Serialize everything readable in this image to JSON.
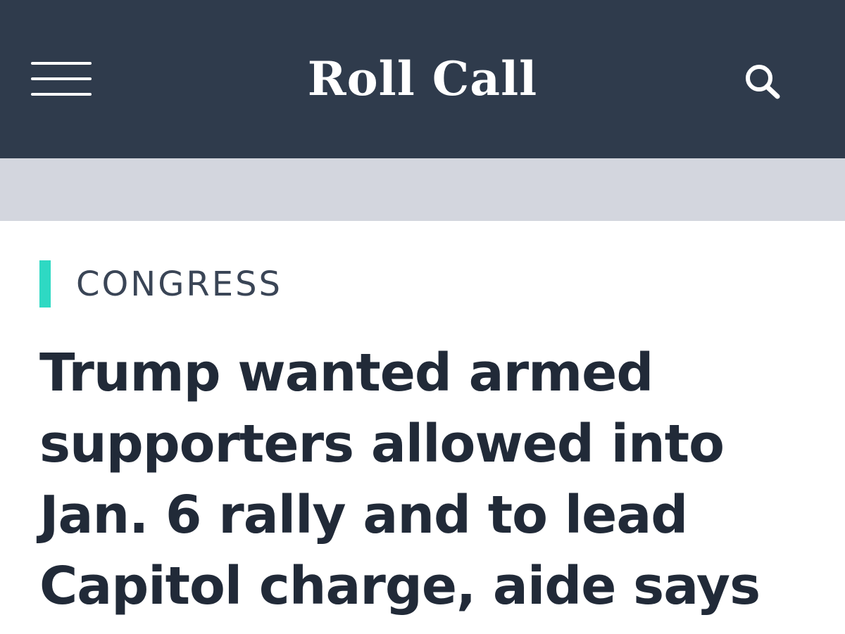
{
  "header": {
    "logo": "Roll Call",
    "menu_icon": "hamburger-menu-icon",
    "search_icon": "search-icon",
    "background_color": "#2f3b4c"
  },
  "ad_band": {
    "background_color": "#d3d6de"
  },
  "article": {
    "category": "CONGRESS",
    "category_accent_color": "#2ed9c3",
    "headline": "Trump wanted armed supporters allowed into Jan. 6 rally and to lead Capitol charge, aide says"
  }
}
